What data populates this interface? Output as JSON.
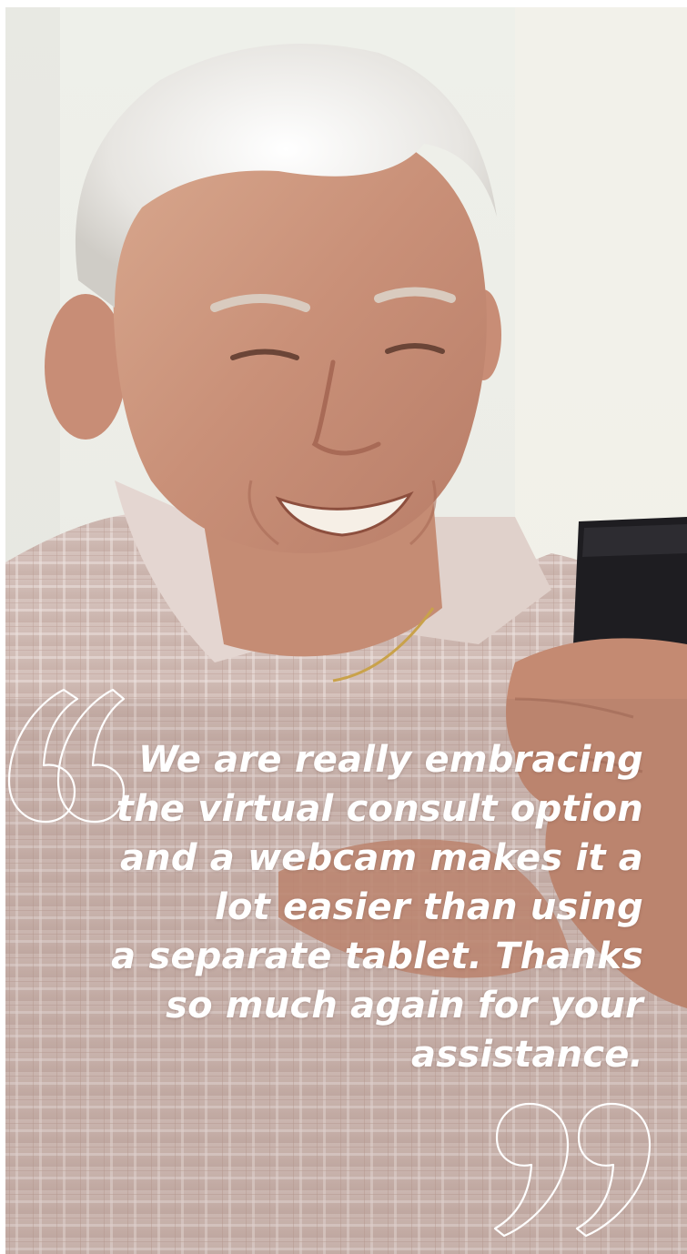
{
  "testimonial": {
    "lines": [
      "We are really embracing",
      "the virtual consult option",
      "and a webcam makes it a",
      "lot easier than using",
      "a separate tablet. Thanks",
      "so much again for your",
      "assistance."
    ]
  },
  "colors": {
    "quote_text": "#ffffff",
    "quote_mark_outline": "#ffffff"
  },
  "icons": {
    "open": "open-quote-icon",
    "close": "close-quote-icon"
  }
}
